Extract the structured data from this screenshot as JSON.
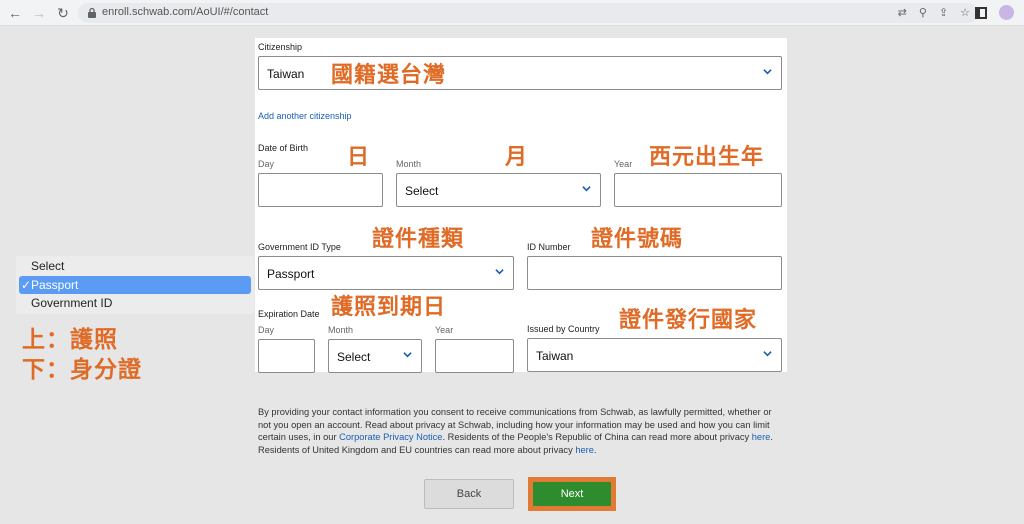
{
  "browser": {
    "url": "enroll.schwab.com/AoUI/#/contact",
    "back_glyph": "←",
    "forward_glyph": "→",
    "reload_glyph": "↻",
    "toolbar_glyphs": [
      "⇄",
      "⚲",
      "⇪",
      "☆"
    ]
  },
  "form": {
    "citizenship": {
      "label": "Citizenship",
      "value": "Taiwan",
      "add_link": "Add another citizenship"
    },
    "dob": {
      "label": "Date of Birth",
      "day_label": "Day",
      "month_label": "Month",
      "year_label": "Year",
      "day_value": "",
      "month_value": "Select",
      "year_value": ""
    },
    "gov_id_type": {
      "label": "Government ID Type",
      "value": "Passport"
    },
    "id_number": {
      "label": "ID Number",
      "value": ""
    },
    "expiration": {
      "label": "Expiration Date",
      "day_label": "Day",
      "month_label": "Month",
      "year_label": "Year",
      "day_value": "",
      "month_value": "Select",
      "year_value": ""
    },
    "issued_by": {
      "label": "Issued by Country",
      "value": "Taiwan"
    }
  },
  "annotations": {
    "citizenship": "國籍選台灣",
    "day": "日",
    "month": "月",
    "year": "西元出生年",
    "id_type": "證件種類",
    "id_number": "證件號碼",
    "expiration": "護照到期日",
    "issued_by": "證件發行國家",
    "side_top": "上：護照",
    "side_bottom": "下：身分證"
  },
  "dropdown_popup": {
    "options": [
      "Select",
      "Passport",
      "Government ID"
    ],
    "selected": "Passport",
    "check_glyph": "✓"
  },
  "disclosure": {
    "part1": "By providing your contact information you consent to receive communications from Schwab, as lawfully permitted, whether or not you open an account. Read about privacy at Schwab, including how your information may be used and how you can limit certain uses, in our ",
    "link1": "Corporate Privacy Notice",
    "part2": ". Residents of the People's Republic of China can read more about privacy ",
    "link2": "here",
    "part3": ". Residents of United Kingdom and EU countries can read more about privacy ",
    "link3": "here",
    "part4": "."
  },
  "buttons": {
    "back": "Back",
    "next": "Next"
  },
  "colors": {
    "annotation": "#e06b27",
    "next_button": "#2e8b2e",
    "link": "#1a5fb4",
    "menu_highlight": "#5b9bf3"
  }
}
